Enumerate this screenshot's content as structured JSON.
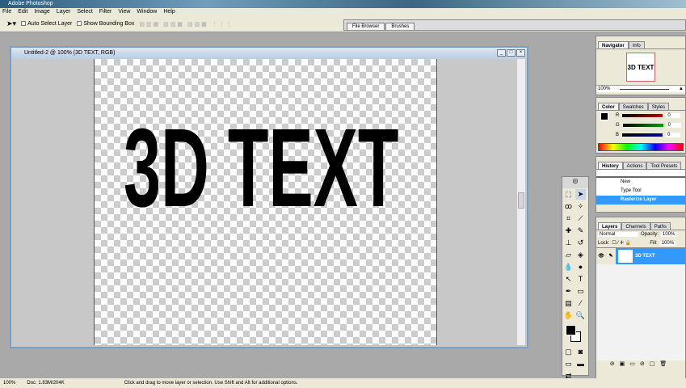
{
  "app": {
    "title": "Adobe Photoshop"
  },
  "menu": [
    "File",
    "Edit",
    "Image",
    "Layer",
    "Select",
    "Filter",
    "View",
    "Window",
    "Help"
  ],
  "options": {
    "auto_select": "Auto Select Layer",
    "show_bbox": "Show Bounding Box"
  },
  "well": {
    "tabs": [
      "File Browser",
      "Brushes"
    ]
  },
  "document": {
    "title": "Untitled-2 @ 100% (3D TEXT, RGB)",
    "canvas_text": "3D TEXT"
  },
  "navigator": {
    "tabs": [
      "Navigator",
      "Info"
    ],
    "zoom": "100%",
    "thumb_text": "3D TEXT"
  },
  "color": {
    "tabs": [
      "Color",
      "Swatches",
      "Styles"
    ],
    "channels": [
      {
        "label": "R",
        "value": "0",
        "color": "#c00000"
      },
      {
        "label": "G",
        "value": "0",
        "color": "#00a000"
      },
      {
        "label": "B",
        "value": "0",
        "color": "#0000a0"
      }
    ]
  },
  "history": {
    "tabs": [
      "History",
      "Actions",
      "Tool Presets"
    ],
    "items": [
      "New",
      "Type Tool",
      "Rasterize Layer"
    ]
  },
  "layers": {
    "tabs": [
      "Layers",
      "Channels",
      "Paths"
    ],
    "blend": "Normal",
    "opacity_label": "Opacity:",
    "opacity": "100%",
    "lock_label": "Lock:",
    "fill_label": "Fill:",
    "fill": "100%",
    "layer_name": "3D TEXT"
  },
  "status": {
    "zoom": "100%",
    "doc": "Doc: 1.83M/204K",
    "hint": "Click and drag to move layer or selection. Use Shift and Alt for additional options."
  }
}
